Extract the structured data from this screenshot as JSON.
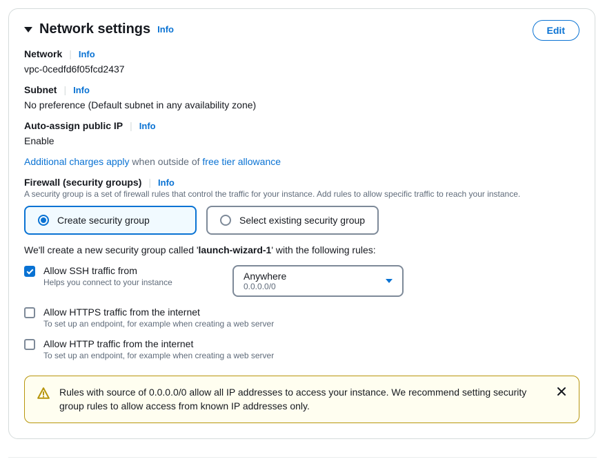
{
  "panel": {
    "title": "Network settings",
    "info_label": "Info",
    "edit_label": "Edit"
  },
  "network": {
    "label": "Network",
    "info": "Info",
    "value": "vpc-0cedfd6f05fcd2437"
  },
  "subnet": {
    "label": "Subnet",
    "info": "Info",
    "value": "No preference (Default subnet in any availability zone)"
  },
  "auto_ip": {
    "label": "Auto-assign public IP",
    "info": "Info",
    "value": "Enable"
  },
  "charges": {
    "link": "Additional charges apply",
    "mid": " when outside of ",
    "link2": "free tier allowance"
  },
  "firewall": {
    "label": "Firewall (security groups)",
    "info": "Info",
    "desc": "A security group is a set of firewall rules that control the traffic for your instance. Add rules to allow specific traffic to reach your instance."
  },
  "radio": {
    "create": "Create security group",
    "select": "Select existing security group"
  },
  "sg_text": {
    "pre": "We'll create a new security group called '",
    "name": "launch-wizard-1",
    "post": "' with the following rules:"
  },
  "ssh": {
    "label": "Allow SSH traffic from",
    "help": "Helps you connect to your instance",
    "dropdown_main": "Anywhere",
    "dropdown_sub": "0.0.0.0/0"
  },
  "https": {
    "label": "Allow HTTPS traffic from the internet",
    "help": "To set up an endpoint, for example when creating a web server"
  },
  "http": {
    "label": "Allow HTTP traffic from the internet",
    "help": "To set up an endpoint, for example when creating a web server"
  },
  "warning": {
    "text": "Rules with source of 0.0.0.0/0 allow all IP addresses to access your instance. We recommend setting security group rules to allow access from known IP addresses only."
  }
}
